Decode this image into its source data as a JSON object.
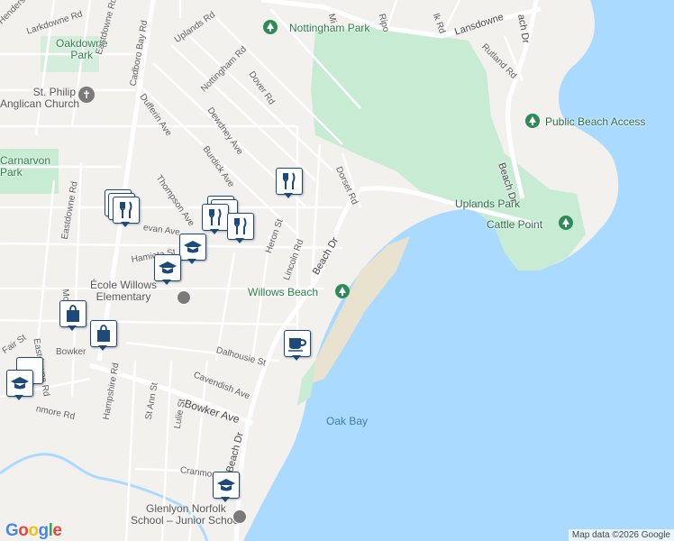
{
  "map": {
    "attribution": "Map data ©2026 Google",
    "logo": "Google"
  },
  "places": {
    "nottingham_park": "Nottingham Park",
    "oakdowne_park": "Oakdowne\nPark",
    "st_philip": "St. Philip\nAnglican Church",
    "carnarvon_park": "Carnarvon\nPark",
    "public_beach_access": "Public Beach Access",
    "uplands_park": "Uplands Park",
    "cattle_point": "Cattle Point",
    "willows_beach": "Willows Beach",
    "ecole_willows": "École Willows\nElementary",
    "glenlyon": "Glenlyon Norfolk\nSchool – Junior School",
    "oak_bay": "Oak Bay"
  },
  "streets": {
    "henderson": "Henderson",
    "larkdowne": "Larkdowne Rd",
    "eastdowne_top": "Eastdowne Rd",
    "cadboro_bay": "Cadboro Bay Rd",
    "uplands": "Uplands Rd",
    "nottingham": "Nottingham Rd",
    "dover": "Dover Rd",
    "dewdney": "Dewdney Ave",
    "dufferin": "Dufferin Ave",
    "burdick": "Burdick Ave",
    "thompson": "Thompson Ave",
    "heron": "Heron St",
    "lincoln": "Lincoln Rd",
    "dorset": "Dorset Rd",
    "beach_dr_mid": "Beach Dr",
    "beach_dr_low": "Beach Dr",
    "beach_dr_right": "Beach Dr",
    "lansdowne": "Lansdowne",
    "rutland": "Rutland Rd",
    "ripon": "Ripo",
    "milton": "Mi",
    "falk": "lk Rd",
    "beach_dr_top": "ach Dr",
    "eastdowne_left": "Eastdowne Rd",
    "eastdowne_low": "Eastdowne Rd",
    "mowat": "Mow",
    "bowker_rd": "Bowker",
    "bowker_ave": "Bowker Ave",
    "fair": "Fair St",
    "dalhousie": "Dalhousie St",
    "cavendish": "Cavendish Ave",
    "hampshire": "Hampshire Rd",
    "st_ann": "St Ann St",
    "lulie": "Lulie St",
    "cranmore_left": "nmore Rd",
    "cranmore": "Cranmore",
    "estevan": "evan Ave",
    "hamiota": "Hamiota St"
  },
  "icons": {
    "restaurant": "fork-knife-icon",
    "school": "graduation-cap-icon",
    "shopping": "shopping-bag-icon",
    "cafe": "coffee-cup-icon",
    "park": "tree-icon",
    "church": "cross-icon"
  },
  "colors": {
    "water": "#aadaff",
    "park": "#c8ebd4",
    "land": "#f3f1ee",
    "road": "#ffffff",
    "pin_border": "#1e4a7a"
  }
}
